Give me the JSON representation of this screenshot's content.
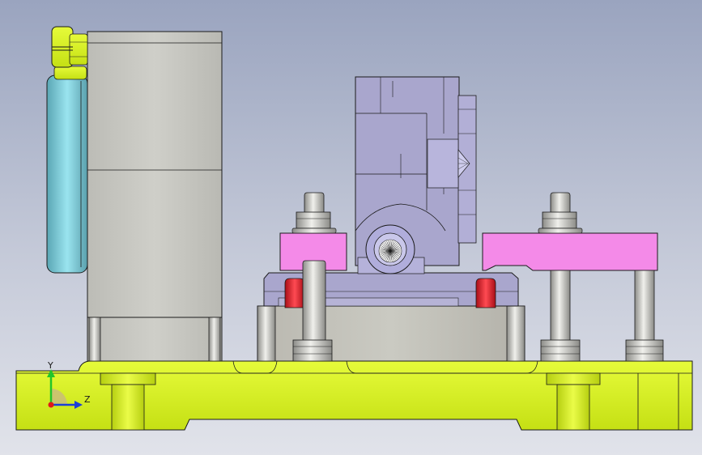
{
  "viewport": {
    "background_top": "#9aa4bf",
    "background_bottom": "#e1e3ea"
  },
  "triad": {
    "y_label": "Y",
    "z_label": "Z",
    "y_color": "#22c52a",
    "z_color": "#1c3fd6",
    "x_color": "#e01818"
  },
  "colors": {
    "base_plate": "#d8f21e",
    "housing": "#c4c4be",
    "fixture_block": "#a9a6cd",
    "clamp_arm": "#f48ae8",
    "locator_pin": "#e01d2a",
    "disc": "#7ad4e2",
    "edge": "#1b1b1b"
  },
  "icons": [
    "coordinate-triad-icon"
  ]
}
